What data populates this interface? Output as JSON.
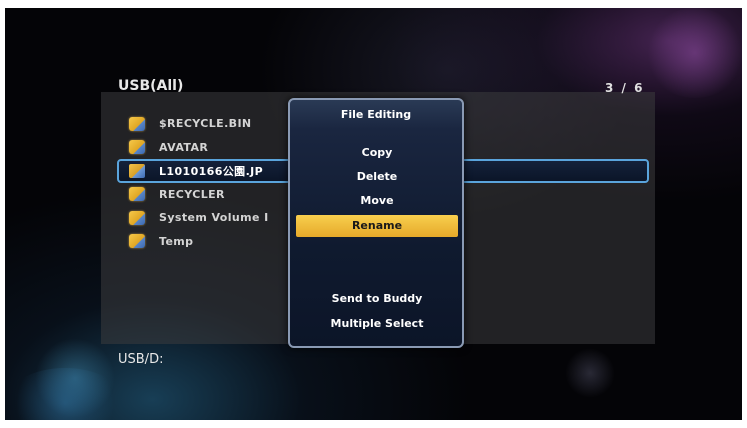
{
  "header": {
    "title": "USB(All)",
    "count": "3 / 6"
  },
  "files": [
    {
      "name": "$RECYCLE.BIN",
      "type": "folder",
      "selected": false
    },
    {
      "name": "AVATAR",
      "type": "folder",
      "selected": false
    },
    {
      "name": "L1010166公園.JP",
      "type": "file",
      "selected": true
    },
    {
      "name": "RECYCLER",
      "type": "folder",
      "selected": false
    },
    {
      "name": "System Volume I",
      "type": "folder",
      "selected": false
    },
    {
      "name": "Temp",
      "type": "folder",
      "selected": false
    }
  ],
  "path": "USB/D:",
  "menu": {
    "title": "File Editing",
    "items": {
      "copy": "Copy",
      "delete": "Delete",
      "move": "Move",
      "rename": "Rename",
      "send_to_buddy": "Send to Buddy",
      "multiple_select": "Multiple Select"
    },
    "active": "Rename"
  },
  "colors": {
    "highlight": "#f2bd3c",
    "selection_border": "#5aa4dc",
    "menu_border": "#8a9ab4"
  }
}
